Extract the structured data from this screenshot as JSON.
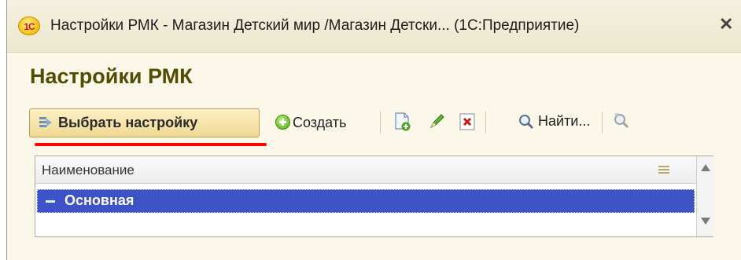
{
  "window": {
    "title": "Настройки РМК - Магазин Детский мир /Магазин Детски... (1С:Предприятие)",
    "logo_text": "1С",
    "close_glyph": "✕"
  },
  "heading": "Настройки РМК",
  "toolbar": {
    "select_label": "Выбрать настройку",
    "create_label": "Создать",
    "find_label": "Найти...",
    "icons": [
      "copy-document-icon",
      "edit-pencil-icon",
      "delete-icon",
      "search-icon",
      "search-clear-icon"
    ]
  },
  "grid": {
    "column_header": "Наименование",
    "rows": [
      {
        "label": "Основная",
        "selected": true
      }
    ]
  },
  "colors": {
    "selection": "#3d52c6",
    "highlight_underline": "#ff0000",
    "heading": "#514c03"
  }
}
